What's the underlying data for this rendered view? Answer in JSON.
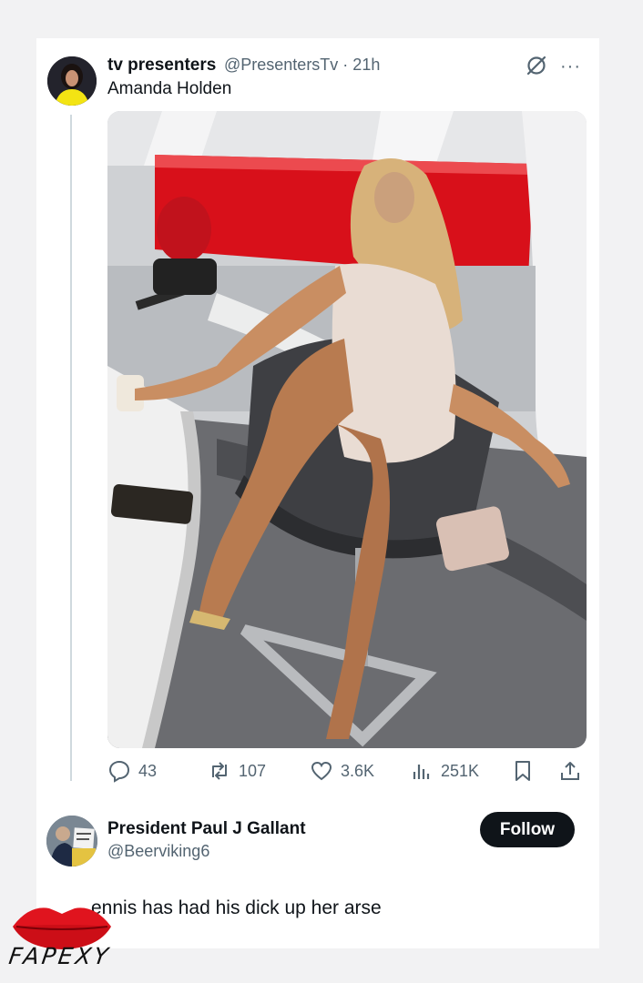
{
  "tweet": {
    "display_name": "tv presenters",
    "handle": "@PresentersTv",
    "time_meta": "@PresentersTv · 21h",
    "text": "Amanda Holden",
    "icons": [
      "grok-icon",
      "more-icon"
    ],
    "more_label": "···"
  },
  "stats": {
    "replies": "43",
    "reposts": "107",
    "likes": "3.6K",
    "views": "251K"
  },
  "reply": {
    "display_name": "President Paul J Gallant",
    "handle": "@Beerviking6",
    "follow_label": "Follow",
    "text": "ennis has had his dick up her arse"
  },
  "watermark": {
    "text": "FAPEXY",
    "lips_color": "#e0141e"
  },
  "colors": {
    "accent_dark": "#0f1419",
    "muted": "#536471",
    "studio_red": "#d8101a"
  }
}
